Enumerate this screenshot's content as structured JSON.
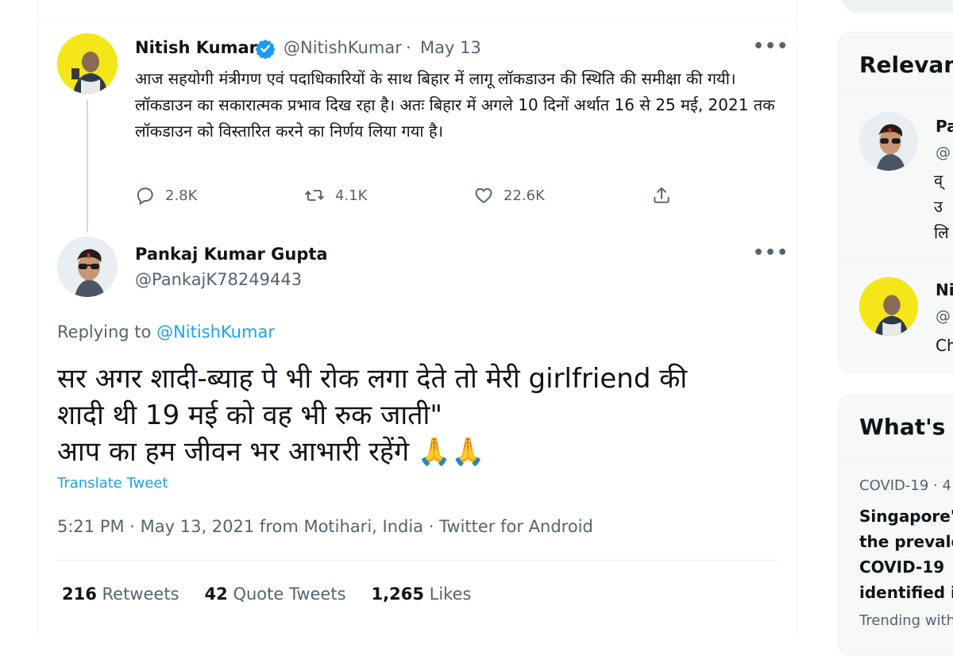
{
  "original_tweet": {
    "author_name": "Nitish Kumar",
    "handle": "@NitishKumar",
    "separator": "·",
    "date": "May 13",
    "more_label": "•••",
    "text": "आज सहयोगी मंत्रीगण एवं पदाधिकारियों के साथ बिहार में लागू लॉकडाउन की स्थिति की समीक्षा की गयी। लॉकडाउन का सकारात्मक प्रभाव दिख रहा है। अतः बिहार में अगले 10 दिनों अर्थात 16 से 25 मई, 2021 तक लॉकडाउन को विस्तारित करने का निर्णय लिया गया है।",
    "replies": "2.8K",
    "retweets": "4.1K",
    "likes": "22.6K"
  },
  "reply_tweet": {
    "author_name": "Pankaj Kumar Gupta",
    "handle": "@PankajK78249443",
    "more_label": "•••",
    "replying_to_label": "Replying to",
    "replying_to_handle": "@NitishKumar",
    "text_line1": "सर अगर शादी-ब्याह पे भी रोक लगा देते तो मेरी girlfriend की",
    "text_line2": "शादी थी 19 मई को वह भी रुक जाती\"",
    "text_line3": "आप का हम जीवन भर आभारी रहेंगे 🙏🙏",
    "translate_label": "Translate Tweet",
    "meta": "5:21 PM · May 13, 2021 from Motihari, India · Twitter for Android",
    "retweets_count": "216",
    "retweets_label": "Retweets",
    "quote_count": "42",
    "quote_label": "Quote Tweets",
    "likes_count": "1,265",
    "likes_label": "Likes"
  },
  "sidebar": {
    "relevant_title": "Relevan",
    "relevant_people": [
      {
        "name": "Pa",
        "handle": "@",
        "bio_lines": [
          "व्",
          "उ",
          "लि"
        ]
      },
      {
        "name": "Ni",
        "handle": "@",
        "bio_lines": [
          "Ch"
        ]
      }
    ],
    "whats_title": "What's",
    "trend": {
      "category": "COVID-19 · 4",
      "headline_lines": [
        "Singapore'",
        "the prevale",
        "COVID-19 ",
        "identified i"
      ],
      "footer": "Trending with"
    }
  },
  "colors": {
    "link_blue": "#1da1f2",
    "muted": "#536471",
    "text": "#0f1419",
    "verified_blue": "#1d9bf0",
    "avatar_yellow": "#f5e61a"
  }
}
